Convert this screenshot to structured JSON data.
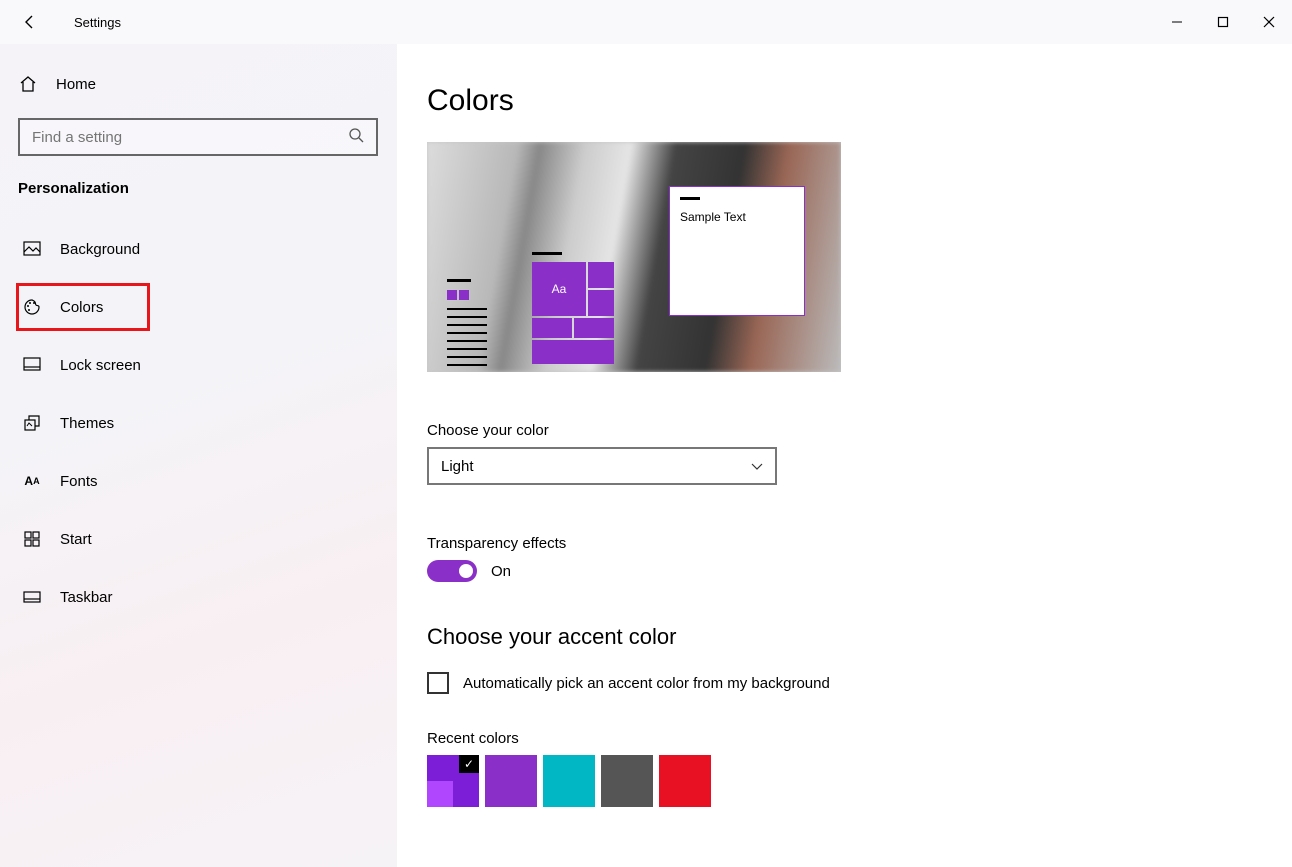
{
  "titlebar": {
    "title": "Settings"
  },
  "sidebar": {
    "home": "Home",
    "search_placeholder": "Find a setting",
    "section": "Personalization",
    "items": [
      {
        "label": "Background"
      },
      {
        "label": "Colors"
      },
      {
        "label": "Lock screen"
      },
      {
        "label": "Themes"
      },
      {
        "label": "Fonts"
      },
      {
        "label": "Start"
      },
      {
        "label": "Taskbar"
      }
    ]
  },
  "page": {
    "title": "Colors",
    "preview": {
      "tile_text": "Aa",
      "sample_text": "Sample Text"
    },
    "choose_color_label": "Choose your color",
    "choose_color_value": "Light",
    "transparency_label": "Transparency effects",
    "transparency_value": "On",
    "accent_title": "Choose your accent color",
    "auto_pick_label": "Automatically pick an accent color from my background",
    "recent_label": "Recent colors",
    "recent_colors": [
      "#7c1ed8",
      "#8b2fc9",
      "#00b7c3",
      "#555555",
      "#e81123"
    ],
    "selected_recent": 0,
    "accent_inner": "#b146ff"
  }
}
